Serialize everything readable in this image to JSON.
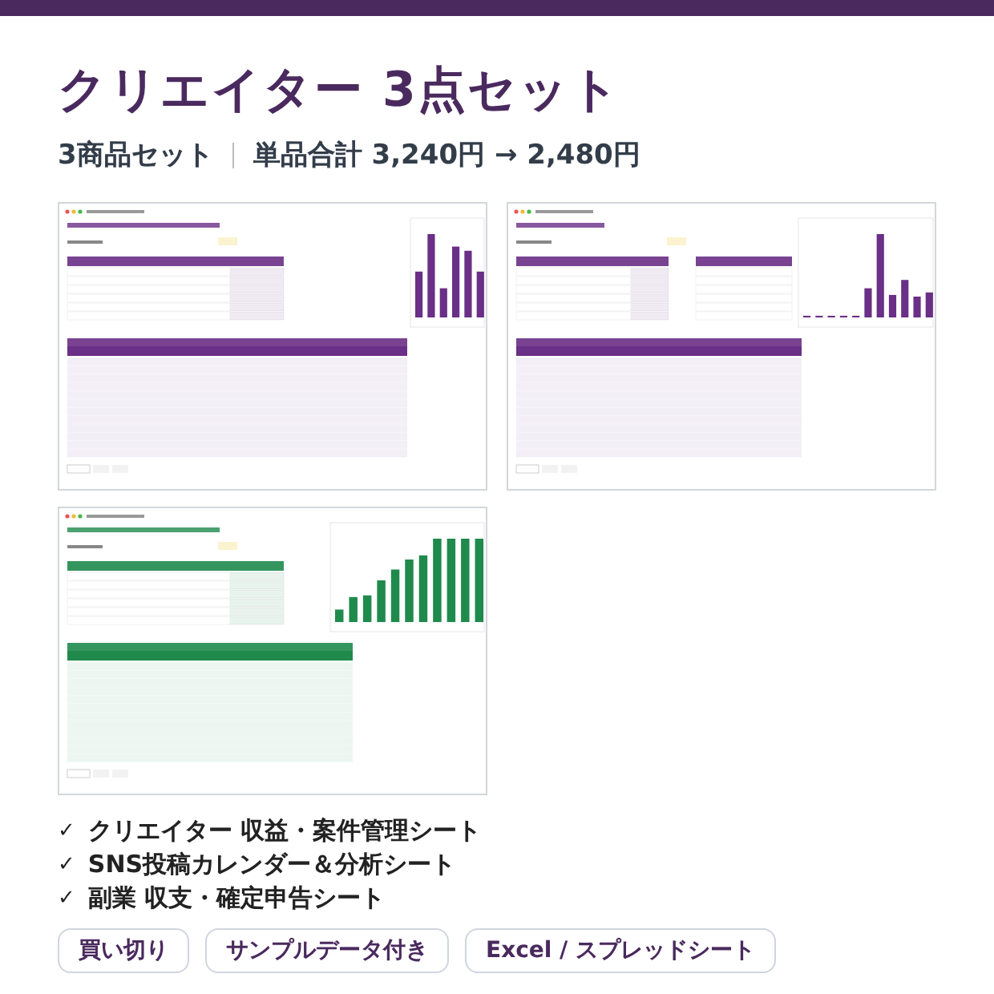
{
  "header": {
    "title": "クリエイター 3点セット",
    "subtitle_parts": [
      "3商品セット",
      "単品合計 3,240円 → 2,480円"
    ]
  },
  "previews": [
    {
      "color": "#6a2f86"
    },
    {
      "color": "#6a2f86"
    },
    {
      "color": "#1f8a4c"
    }
  ],
  "checklist": [
    {
      "mark": "✓",
      "label": "クリエイター 収益・案件管理シート"
    },
    {
      "mark": "✓",
      "label": "SNS投稿カレンダー＆分析シート"
    },
    {
      "mark": "✓",
      "label": "副業 収支・確定申告シート"
    }
  ],
  "tags": [
    "買い切り",
    "サンプルデータ付き",
    "Excel / スプレッドシート"
  ]
}
